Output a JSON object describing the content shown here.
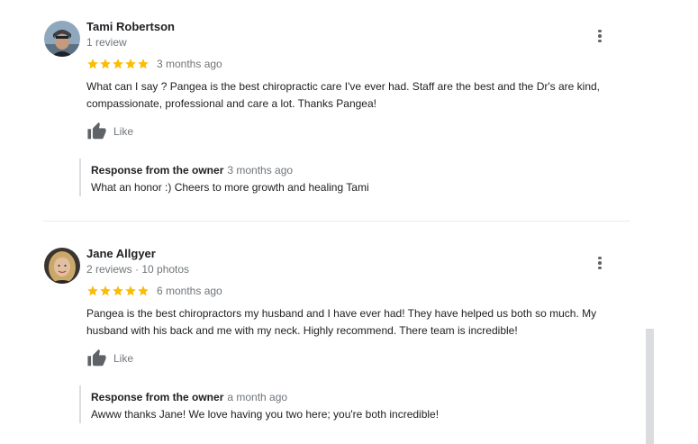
{
  "reviews": [
    {
      "name": "Tami Robertson",
      "meta": "1 review",
      "rating": 5,
      "date": "3 months ago",
      "text": "What can I say ? Pangea is the best chiropractic care I've ever had.  Staff are the best and the Dr's are kind, compassionate, professional and care a lot.  Thanks Pangea!",
      "like_label": "Like",
      "response": {
        "heading": "Response from the owner",
        "date": "3 months ago",
        "text": "What an honor :) Cheers to more growth and healing Tami"
      }
    },
    {
      "name": "Jane Allgyer",
      "meta": "2 reviews · 10 photos",
      "rating": 5,
      "date": "6 months ago",
      "text": "Pangea is the best chiropractors my husband and I have ever had! They have helped us both so much. My husband with his back and me with my neck. Highly recommend. There team is incredible!",
      "like_label": "Like",
      "response": {
        "heading": "Response from the owner",
        "date": "a month ago",
        "text": "Awww thanks Jane! We love having you two here; you're both incredible!"
      }
    }
  ],
  "icons": {
    "star": "star-icon",
    "like": "thumbs-up-icon",
    "more": "more-vert-icon"
  },
  "colors": {
    "star": "#fbbc04",
    "secondary_text": "#70757a",
    "icon": "#5f6368"
  }
}
